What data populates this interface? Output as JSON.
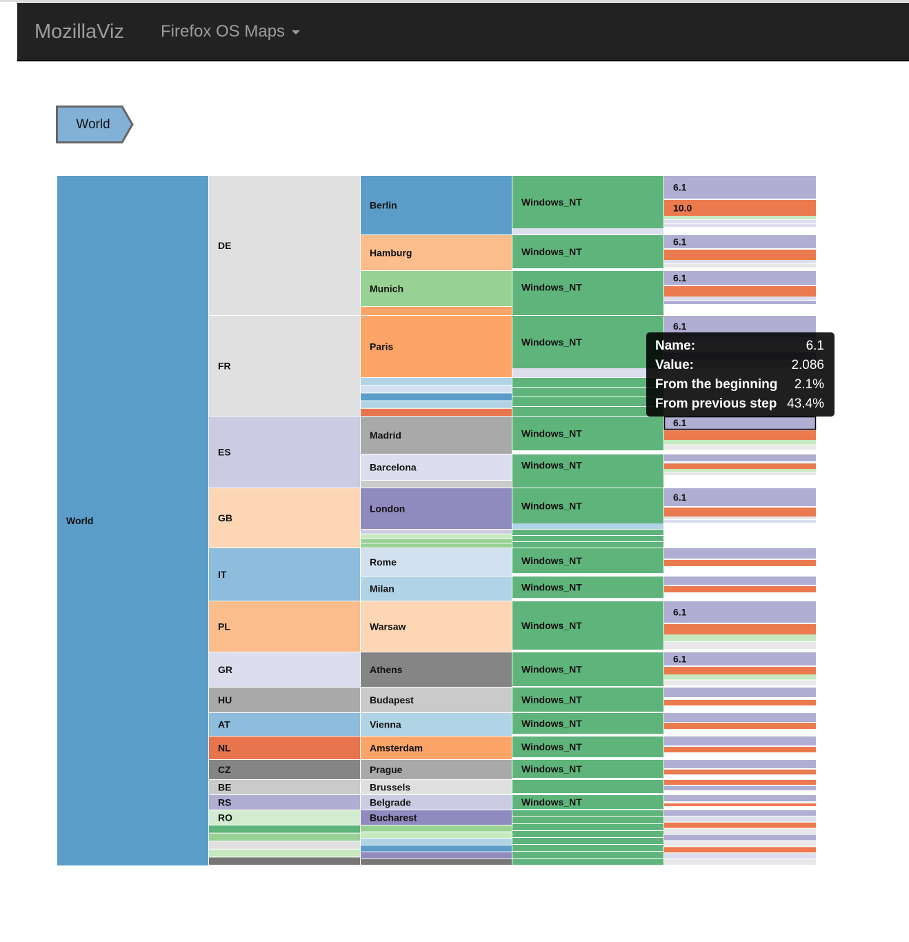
{
  "navbar": {
    "brand": "MozillaViz",
    "menu_label": "Firefox OS Maps"
  },
  "breadcrumb": {
    "items": [
      "World"
    ],
    "color": "#82b1d8"
  },
  "palette": {
    "windows_nt": "#5eb47a",
    "version_6_1": "#b0aed2",
    "version_10_0": "#eb7a4f",
    "light_green": "#c7e9c0"
  },
  "chart": {
    "root": "World",
    "countries": [
      "DE",
      "FR",
      "ES",
      "GB",
      "IT",
      "PL",
      "GR",
      "HU",
      "AT",
      "NL",
      "CZ",
      "BE",
      "RS",
      "RO"
    ],
    "cities": [
      "Berlin",
      "Hamburg",
      "Munich",
      "Paris",
      "Madrid",
      "Barcelona",
      "London",
      "Rome",
      "Milan",
      "Warsaw",
      "Athens",
      "Budapest",
      "Vienna",
      "Amsterdam",
      "Prague",
      "Brussels",
      "Belgrade",
      "Bucharest"
    ],
    "os_label": "Windows_NT",
    "versions": [
      "6.1",
      "10.0"
    ]
  },
  "tooltip": {
    "name_label": "Name:",
    "name_value": "6.1",
    "value_label": "Value:",
    "value_value": "2.086",
    "beginning_label": "From the beginning",
    "beginning_value": "2.1%",
    "previous_label": "From previous step",
    "previous_value": "43.4%"
  }
}
